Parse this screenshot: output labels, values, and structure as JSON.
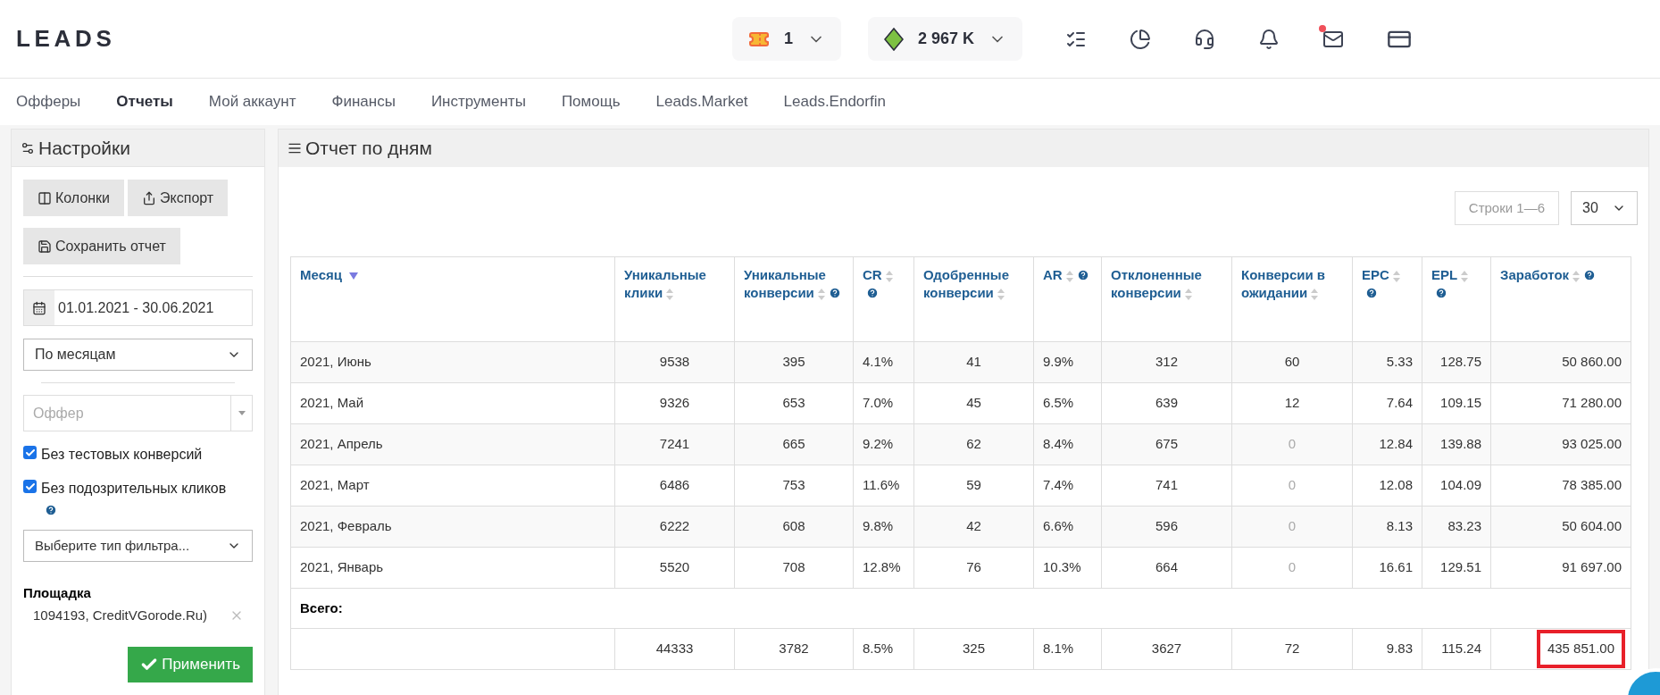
{
  "logo": "LEADS",
  "top_widgets": [
    {
      "kind": "tickets",
      "value": "1"
    },
    {
      "kind": "balance",
      "value": "2 967 K"
    }
  ],
  "mail_unread": true,
  "nav": [
    {
      "label": "Офферы",
      "selected": false
    },
    {
      "label": "Отчеты",
      "selected": true
    },
    {
      "label": "Мой аккаунт",
      "selected": false
    },
    {
      "label": "Финансы",
      "selected": false
    },
    {
      "label": "Инструменты",
      "selected": false
    },
    {
      "label": "Помощь",
      "selected": false
    },
    {
      "label": "Leads.Market",
      "selected": false
    },
    {
      "label": "Leads.Endorfin",
      "selected": false
    }
  ],
  "sidebar": {
    "title": "Настройки",
    "columns_button": "Колонки",
    "export_button": "Экспорт",
    "save_button": "Сохранить отчет",
    "date_range": "01.01.2021 - 30.06.2021",
    "grouping": "По месяцам",
    "offer_placeholder": "Оффер",
    "checkboxes": [
      {
        "label": "Без тестовых конверсий",
        "checked": true,
        "help": false
      },
      {
        "label": "Без подозрительных кликов",
        "checked": true,
        "help": true
      }
    ],
    "filter_type": "Выберите тип фильтра...",
    "platform_label": "Площадка",
    "platform_value": "1094193, CreditVGorode.Ru)",
    "apply_button": "Применить"
  },
  "report": {
    "title": "Отчет по дням",
    "rows_info": "Строки 1—6",
    "page_size": "30",
    "columns": [
      {
        "label": "Месяц",
        "sorted": true,
        "help": false
      },
      {
        "label": "Уникальные клики",
        "sorted": false,
        "help": false
      },
      {
        "label": "Уникальные конверсии",
        "sorted": false,
        "help": true
      },
      {
        "label": "CR",
        "sorted": false,
        "help": true
      },
      {
        "label": "Одобренные конверсии",
        "sorted": false,
        "help": false
      },
      {
        "label": "AR",
        "sorted": false,
        "help": true
      },
      {
        "label": "Отклоненные конверсии",
        "sorted": false,
        "help": false
      },
      {
        "label": "Конверсии в ожидании",
        "sorted": false,
        "help": false
      },
      {
        "label": "EPC",
        "sorted": false,
        "help": true
      },
      {
        "label": "EPL",
        "sorted": false,
        "help": true
      },
      {
        "label": "Заработок",
        "sorted": false,
        "help": true
      }
    ],
    "rows": [
      {
        "cells": [
          "2021, Июнь",
          "9538",
          "395",
          "4.1%",
          "41",
          "9.9%",
          "312",
          "60",
          "5.33",
          "128.75",
          "50 860.00"
        ],
        "pending_muted": false
      },
      {
        "cells": [
          "2021, Май",
          "9326",
          "653",
          "7.0%",
          "45",
          "6.5%",
          "639",
          "12",
          "7.64",
          "109.15",
          "71 280.00"
        ],
        "pending_muted": false
      },
      {
        "cells": [
          "2021, Апрель",
          "7241",
          "665",
          "9.2%",
          "62",
          "8.4%",
          "675",
          "0",
          "12.84",
          "139.88",
          "93 025.00"
        ],
        "pending_muted": true
      },
      {
        "cells": [
          "2021, Март",
          "6486",
          "753",
          "11.6%",
          "59",
          "7.4%",
          "741",
          "0",
          "12.08",
          "104.09",
          "78 385.00"
        ],
        "pending_muted": true
      },
      {
        "cells": [
          "2021, Февраль",
          "6222",
          "608",
          "9.8%",
          "42",
          "6.6%",
          "596",
          "0",
          "8.13",
          "83.23",
          "50 604.00"
        ],
        "pending_muted": true
      },
      {
        "cells": [
          "2021, Январь",
          "5520",
          "708",
          "12.8%",
          "76",
          "10.3%",
          "664",
          "0",
          "16.61",
          "129.51",
          "91 697.00"
        ],
        "pending_muted": true
      }
    ],
    "total_label": "Всего:",
    "totals": {
      "cells": [
        "",
        "44333",
        "3782",
        "8.5%",
        "325",
        "8.1%",
        "3627",
        "72",
        "9.83",
        "115.24",
        "435 851.00"
      ],
      "highlight_last": true
    }
  }
}
